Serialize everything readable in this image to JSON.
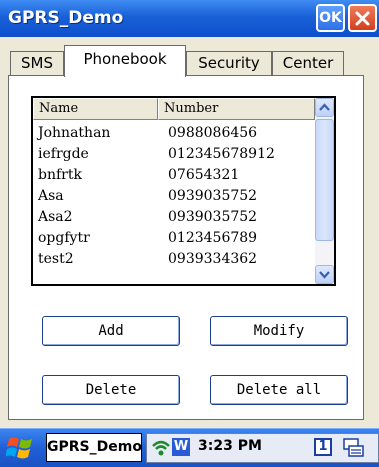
{
  "window": {
    "title": "GPRS_Demo",
    "ok_label": "OK"
  },
  "tabs": [
    {
      "label": "SMS"
    },
    {
      "label": "Phonebook"
    },
    {
      "label": "Security"
    },
    {
      "label": "Center"
    }
  ],
  "active_tab": "Phonebook",
  "list": {
    "columns": [
      "Name",
      "Number"
    ],
    "rows": [
      {
        "name": "Johnathan",
        "number": "0988086456"
      },
      {
        "name": "iefrgde",
        "number": "012345678912"
      },
      {
        "name": "bnfrtk",
        "number": "07654321"
      },
      {
        "name": "Asa",
        "number": "0939035752"
      },
      {
        "name": "Asa2",
        "number": "0939035752"
      },
      {
        "name": "opgfytr",
        "number": "0123456789"
      },
      {
        "name": "test2",
        "number": "0939334362"
      }
    ]
  },
  "buttons": {
    "add": "Add",
    "modify": "Modify",
    "delete": "Delete",
    "delete_all": "Delete all"
  },
  "taskbar": {
    "app": "GPRS_Demo",
    "time": "3:23 PM",
    "w_badge": "W",
    "input_indicator": "1"
  },
  "icons": [
    "close-icon",
    "scroll-up-icon",
    "scroll-down-icon",
    "windows-start-icon",
    "wifi-icon",
    "keyboard-icon"
  ]
}
